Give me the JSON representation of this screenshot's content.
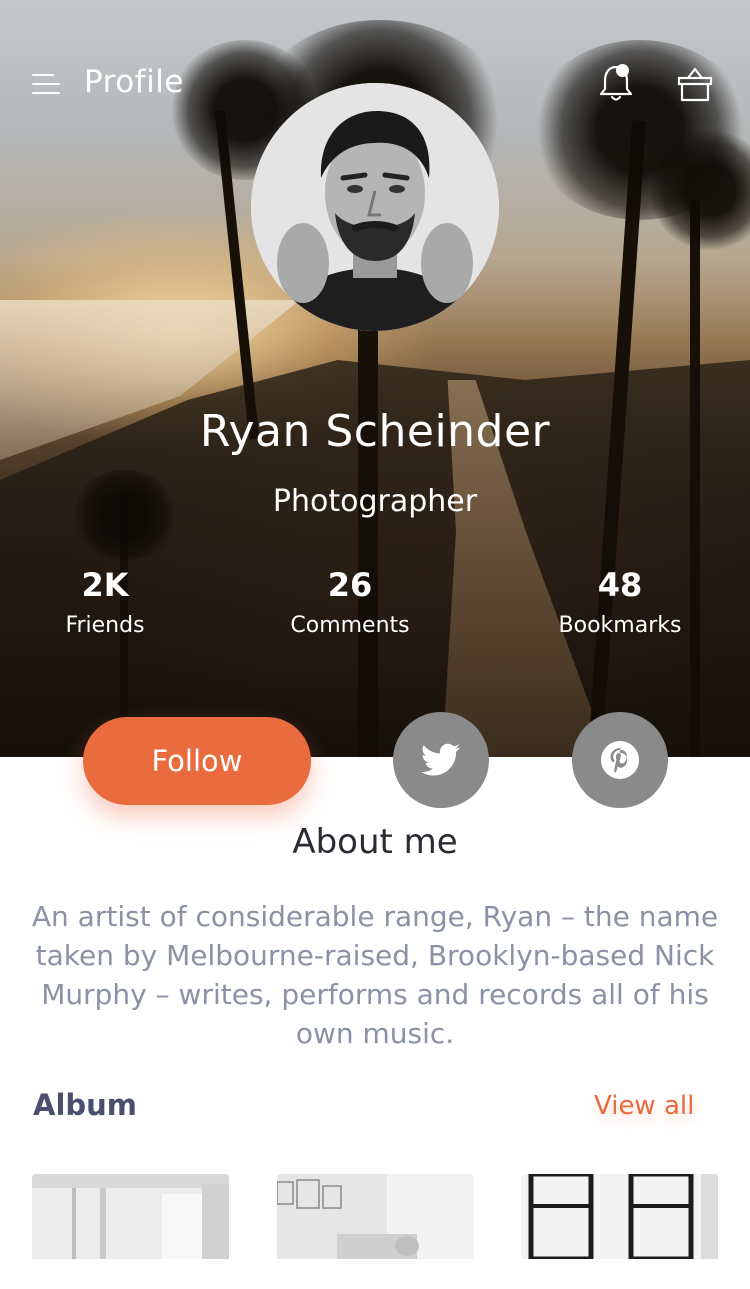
{
  "header": {
    "title": "Profile",
    "menu_icon": "hamburger-menu-icon",
    "notification_icon": "bell-icon",
    "basket_icon": "shopping-basket-icon"
  },
  "profile": {
    "name": "Ryan Scheinder",
    "role": "Photographer"
  },
  "stats": [
    {
      "value": "2K",
      "label": "Friends"
    },
    {
      "value": "26",
      "label": "Comments"
    },
    {
      "value": "48",
      "label": "Bookmarks"
    }
  ],
  "actions": {
    "follow_label": "Follow",
    "twitter_icon": "twitter-icon",
    "pinterest_icon": "pinterest-icon"
  },
  "about": {
    "heading": "About me",
    "text": "An artist of considerable range, Ryan – the name taken by Melbourne-raised, Brooklyn-based Nick Murphy – writes, performs and records all of his own music."
  },
  "album": {
    "heading": "Album",
    "view_all_label": "View all"
  },
  "colors": {
    "accent": "#ea6b3e",
    "heading_dark": "#2b2b33",
    "album_heading": "#4a4f6e",
    "body_text": "#8b92a5",
    "social_button": "#8a8a8a"
  }
}
